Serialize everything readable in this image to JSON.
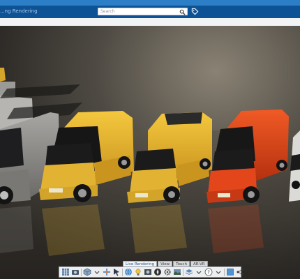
{
  "header": {
    "app_title": "...ng Rendering",
    "search_placeholder": "Search"
  },
  "toolbar": {
    "tabs": [
      "Live Rendering",
      "View",
      "Touch",
      "AR-VR"
    ],
    "active_tab": "Live Rendering"
  },
  "colors": {
    "top_strip": "#2c7fc7",
    "top_bar": "#0e5296",
    "van_yellow": "#e9b731",
    "van_orange": "#e4461c",
    "van_grey": "#8e8c8a"
  }
}
